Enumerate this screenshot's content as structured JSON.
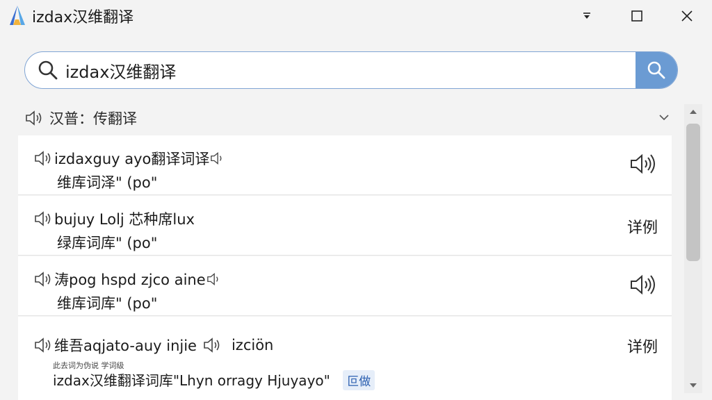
{
  "window": {
    "title": "izdax汉维翻译"
  },
  "search": {
    "value": "izdax汉维翻译",
    "placeholder": ""
  },
  "section": {
    "title": "汉普：传翻译"
  },
  "results": [
    {
      "line1": "izdaxguy ayo翻译词译",
      "line2": "维库词泽\" (po\"",
      "action": "speaker-icon"
    },
    {
      "line1": "bujuy Lolj 芯种席lux",
      "line2": "绿库词库\" (po\"",
      "action_label": "详例"
    },
    {
      "line1": "涛pog hspd zjco aine",
      "line2": "维库词库\" (po\"",
      "action": "speaker-icon"
    },
    {
      "line1_a": "维吾aqjato-auy injie",
      "line1_b": "izciön",
      "note": "此去词为伪说 学词级",
      "line2": "izdax汉维翻译词库\"Lhyn orragy Hjuyayo\"",
      "tag": "叵做",
      "action_label": "详例"
    }
  ],
  "colors": {
    "accent": "#6b9bd3",
    "search_border": "#7fa4d4",
    "background": "#f3f3f3",
    "row_bg": "#ffffff"
  }
}
